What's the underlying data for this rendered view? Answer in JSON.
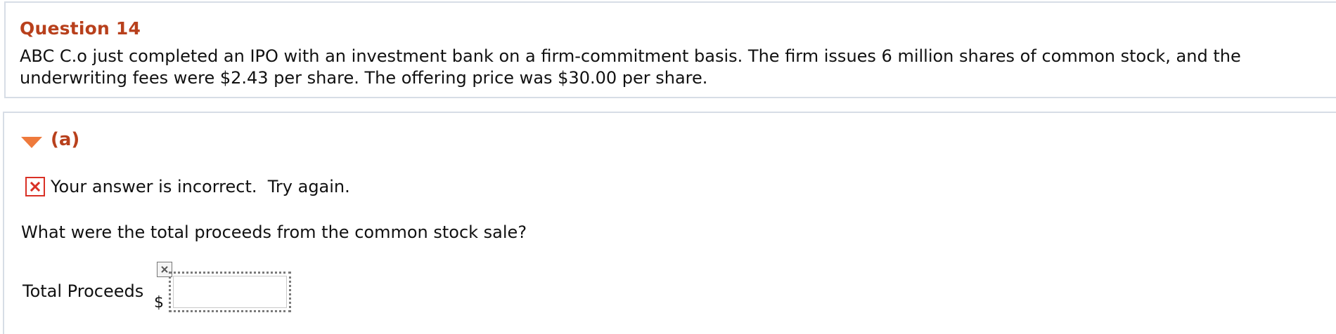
{
  "question": {
    "title": "Question 14",
    "body": "ABC C.o just completed an IPO with an investment bank on a firm-commitment basis. The firm issues 6 million shares of common stock, and the underwriting fees were $2.43 per share. The offering price was $30.00 per share."
  },
  "part": {
    "label": "(a)",
    "feedback": "Your answer is incorrect.  Try again.",
    "prompt": "What were the total proceeds from the common stock sale?",
    "answer_label": "Total Proceeds",
    "currency_symbol": "$",
    "answer_value": ""
  },
  "colors": {
    "accent": "#b8401c",
    "arrow": "#ee7a3c",
    "error": "#d93025",
    "panel_border": "#d7dde6"
  },
  "icons": {
    "toggle": "triangle-down-icon",
    "feedback": "incorrect-x-icon",
    "clear": "clear-x-icon"
  }
}
